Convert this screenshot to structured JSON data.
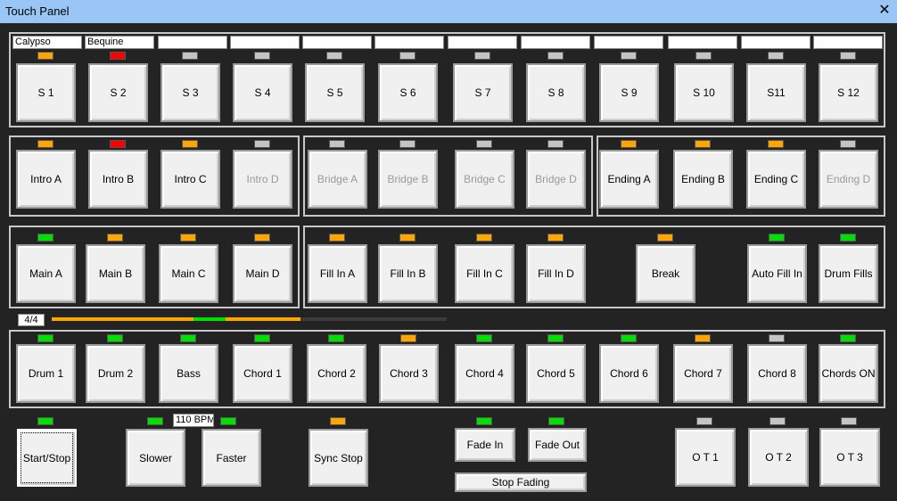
{
  "window": {
    "title": "Touch  Panel",
    "close_glyph": "✕"
  },
  "styles": {
    "fields": [
      "Calypso",
      "Bequine",
      "",
      "",
      "",
      "",
      "",
      "",
      "",
      "",
      "",
      ""
    ],
    "leds": [
      "orange",
      "red",
      "gray",
      "gray",
      "gray",
      "gray",
      "gray",
      "gray",
      "gray",
      "gray",
      "gray",
      "gray"
    ],
    "buttons": [
      "S 1",
      "S 2",
      "S 3",
      "S 4",
      "S 5",
      "S 6",
      "S 7",
      "S 8",
      "S 9",
      "S 10",
      "S11",
      "S 12"
    ]
  },
  "intros": [
    {
      "label": "Intro A",
      "led": "orange",
      "enabled": true
    },
    {
      "label": "Intro B",
      "led": "red",
      "enabled": true
    },
    {
      "label": "Intro C",
      "led": "orange",
      "enabled": true
    },
    {
      "label": "Intro D",
      "led": "gray",
      "enabled": false
    }
  ],
  "bridges": [
    {
      "label": "Bridge A",
      "led": "gray",
      "enabled": false
    },
    {
      "label": "Bridge B",
      "led": "gray",
      "enabled": false
    },
    {
      "label": "Bridge C",
      "led": "gray",
      "enabled": false
    },
    {
      "label": "Bridge D",
      "led": "gray",
      "enabled": false
    }
  ],
  "endings": [
    {
      "label": "Ending A",
      "led": "orange",
      "enabled": true
    },
    {
      "label": "Ending B",
      "led": "orange",
      "enabled": true
    },
    {
      "label": "Ending C",
      "led": "orange",
      "enabled": true
    },
    {
      "label": "Ending D",
      "led": "gray",
      "enabled": false
    }
  ],
  "mains": [
    {
      "label": "Main A",
      "led": "green"
    },
    {
      "label": "Main B",
      "led": "orange"
    },
    {
      "label": "Main C",
      "led": "orange"
    },
    {
      "label": "Main D",
      "led": "orange"
    }
  ],
  "fills": [
    {
      "label": "Fill In A",
      "led": "orange"
    },
    {
      "label": "Fill In B",
      "led": "orange"
    },
    {
      "label": "Fill In C",
      "led": "orange"
    },
    {
      "label": "Fill In D",
      "led": "orange"
    },
    {
      "label": "Break",
      "led": "orange"
    },
    {
      "label": "Auto Fill In",
      "led": "green"
    },
    {
      "label": "Drum Fills",
      "led": "green"
    }
  ],
  "time_signature": "4/4",
  "beat_progress": {
    "segments": [
      {
        "color": "#ffa500",
        "from": 0.0,
        "to": 0.36
      },
      {
        "color": "#00e000",
        "from": 0.36,
        "to": 0.44
      },
      {
        "color": "#ffa500",
        "from": 0.44,
        "to": 0.63
      }
    ]
  },
  "tracks": [
    {
      "label": "Drum 1",
      "led": "green"
    },
    {
      "label": "Drum 2",
      "led": "green"
    },
    {
      "label": "Bass",
      "led": "green"
    },
    {
      "label": "Chord 1",
      "led": "green"
    },
    {
      "label": "Chord 2",
      "led": "green"
    },
    {
      "label": "Chord 3",
      "led": "orange"
    },
    {
      "label": "Chord 4",
      "led": "green"
    },
    {
      "label": "Chord 5",
      "led": "green"
    },
    {
      "label": "Chord 6",
      "led": "green"
    },
    {
      "label": "Chord 7",
      "led": "orange"
    },
    {
      "label": "Chord 8",
      "led": "gray"
    },
    {
      "label": "Chords ON",
      "led": "green"
    }
  ],
  "transport": {
    "start_stop": {
      "label": "Start/Stop",
      "led": "green"
    },
    "slower": {
      "label": "Slower",
      "led": "green"
    },
    "tempo": "110 BPM",
    "faster": {
      "label": "Faster",
      "led": "green"
    },
    "sync_stop": {
      "label": "Sync Stop",
      "led": "orange"
    },
    "fade_in": {
      "label": "Fade In",
      "led": "green"
    },
    "fade_out": {
      "label": "Fade Out",
      "led": "green"
    },
    "stop_fading": "Stop Fading",
    "ot": [
      {
        "label": "O T   1",
        "led": "gray"
      },
      {
        "label": "O T   2",
        "led": "gray"
      },
      {
        "label": "O T   3",
        "led": "gray"
      }
    ]
  }
}
